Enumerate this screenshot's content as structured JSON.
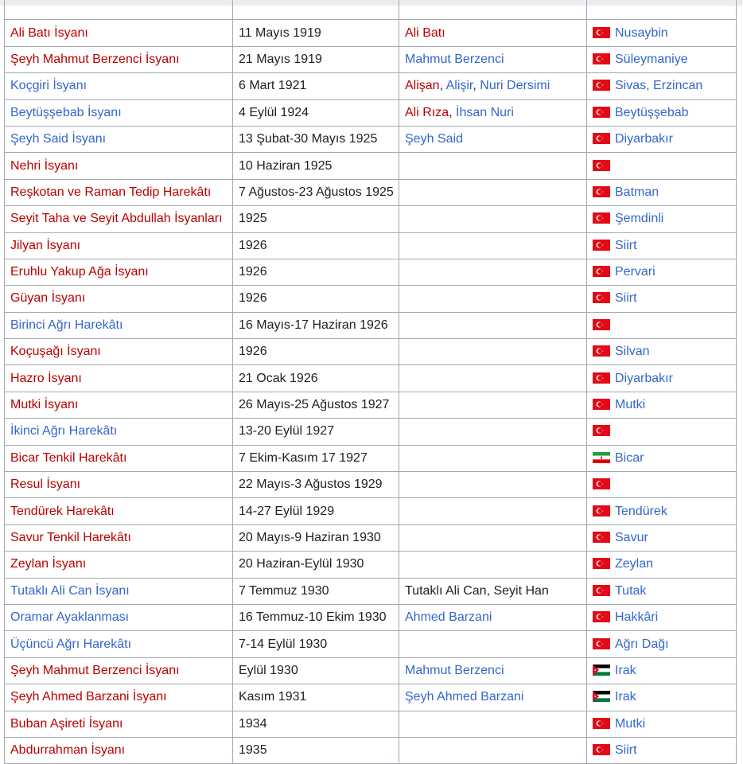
{
  "colors": {
    "link": "#3366cc",
    "redlink": "#ba0000",
    "text": "#202122",
    "border": "#a2a9b1"
  },
  "rows": [
    {
      "name": "",
      "name_style": "blue",
      "date": "",
      "leaders": [],
      "flag": "",
      "place": ""
    },
    {
      "name": "Ali Batı İsyanı",
      "name_style": "red",
      "date": "11 Mayıs 1919",
      "leaders": [
        {
          "text": "Ali Batı",
          "style": "red"
        }
      ],
      "flag": "tr-flag-icon",
      "place": "Nusaybin"
    },
    {
      "name": "Şeyh Mahmut Berzenci İsyanı",
      "name_style": "red",
      "date": "21 Mayıs 1919",
      "leaders": [
        {
          "text": "Mahmut Berzenci",
          "style": "blue"
        }
      ],
      "flag": "tr-flag-icon",
      "place": "Süleymaniye"
    },
    {
      "name": "Koçgiri İsyanı",
      "name_style": "blue",
      "date": "6 Mart 1921",
      "leaders": [
        {
          "text": "Alişan",
          "style": "red"
        },
        {
          "text": ", ",
          "style": "dark"
        },
        {
          "text": "Alişir",
          "style": "blue"
        },
        {
          "text": ", ",
          "style": "dark"
        },
        {
          "text": "Nuri Dersimi",
          "style": "blue"
        }
      ],
      "flag": "tr-flag-icon",
      "place": "Sivas, Erzincan"
    },
    {
      "name": "Beytüşşebab İsyanı",
      "name_style": "blue",
      "date": "4 Eylül 1924",
      "leaders": [
        {
          "text": "Ali Rıza",
          "style": "red"
        },
        {
          "text": ", ",
          "style": "dark"
        },
        {
          "text": "İhsan Nuri",
          "style": "blue"
        }
      ],
      "flag": "tr-flag-icon",
      "place": "Beytüşşebab"
    },
    {
      "name": "Şeyh Said İsyanı",
      "name_style": "blue",
      "date": "13 Şubat-30 Mayıs 1925",
      "leaders": [
        {
          "text": "Şeyh Said",
          "style": "blue"
        }
      ],
      "flag": "tr-flag-icon",
      "place": "Diyarbakır"
    },
    {
      "name": "Nehri İsyanı",
      "name_style": "red",
      "date": "10 Haziran 1925",
      "leaders": [],
      "flag": "tr-flag-icon",
      "place": ""
    },
    {
      "name": "Reşkotan ve Raman Tedip Harekâtı",
      "name_style": "red",
      "date": "7 Ağustos-23 Ağustos 1925",
      "leaders": [],
      "flag": "tr-flag-icon",
      "place": "Batman"
    },
    {
      "name": "Seyit Taha ve Seyit Abdullah İsyanları",
      "name_style": "red",
      "date": "1925",
      "leaders": [],
      "flag": "tr-flag-icon",
      "place": "Şemdinli"
    },
    {
      "name": "Jilyan İsyanı",
      "name_style": "red",
      "date": "1926",
      "leaders": [],
      "flag": "tr-flag-icon",
      "place": "Siirt"
    },
    {
      "name": "Eruhlu Yakup Ağa İsyanı",
      "name_style": "red",
      "date": "1926",
      "leaders": [],
      "flag": "tr-flag-icon",
      "place": "Pervari"
    },
    {
      "name": "Güyan İsyanı",
      "name_style": "red",
      "date": "1926",
      "leaders": [],
      "flag": "tr-flag-icon",
      "place": "Siirt"
    },
    {
      "name": "Birinci Ağrı Harekâtı",
      "name_style": "blue",
      "date": "16 Mayıs-17 Haziran 1926",
      "leaders": [],
      "flag": "tr-flag-icon",
      "place": ""
    },
    {
      "name": "Koçuşağı İsyanı",
      "name_style": "red",
      "date": "1926",
      "leaders": [],
      "flag": "tr-flag-icon",
      "place": "Silvan"
    },
    {
      "name": "Hazro İsyanı",
      "name_style": "red",
      "date": "21 Ocak 1926",
      "leaders": [],
      "flag": "tr-flag-icon",
      "place": "Diyarbakır"
    },
    {
      "name": "Mutki İsyanı",
      "name_style": "red",
      "date": "26 Mayıs-25 Ağustos 1927",
      "leaders": [],
      "flag": "tr-flag-icon",
      "place": "Mutki"
    },
    {
      "name": "İkinci Ağrı Harekâtı",
      "name_style": "blue",
      "date": "13-20 Eylül 1927",
      "leaders": [],
      "flag": "tr-flag-icon",
      "place": ""
    },
    {
      "name": "Bicar Tenkil Harekâtı",
      "name_style": "red",
      "date": "7 Ekim-Kasım 17 1927",
      "leaders": [],
      "flag": "iran-flag-icon",
      "place": "Bicar"
    },
    {
      "name": "Resul İsyanı",
      "name_style": "red",
      "date": "22 Mayıs-3 Ağustos 1929",
      "leaders": [],
      "flag": "tr-flag-icon",
      "place": ""
    },
    {
      "name": "Tendürek Harekâtı",
      "name_style": "red",
      "date": "14-27 Eylül 1929",
      "leaders": [],
      "flag": "tr-flag-icon",
      "place": "Tendürek"
    },
    {
      "name": "Savur Tenkil Harekâtı",
      "name_style": "red",
      "date": "20 Mayıs-9 Haziran 1930",
      "leaders": [],
      "flag": "tr-flag-icon",
      "place": "Savur"
    },
    {
      "name": "Zeylan İsyanı",
      "name_style": "red",
      "date": "20 Haziran-Eylül 1930",
      "leaders": [],
      "flag": "tr-flag-icon",
      "place": "Zeylan"
    },
    {
      "name": "Tutaklı Ali Can İsyanı",
      "name_style": "blue",
      "date": "7 Temmuz 1930",
      "leaders": [
        {
          "text": "Tutaklı Ali Can, Seyit Han",
          "style": "dark"
        }
      ],
      "flag": "tr-flag-icon",
      "place": "Tutak"
    },
    {
      "name": "Oramar Ayaklanması",
      "name_style": "blue",
      "date": "16 Temmuz-10 Ekim 1930",
      "leaders": [
        {
          "text": "Ahmed Barzani",
          "style": "blue"
        }
      ],
      "flag": "tr-flag-icon",
      "place": "Hakkâri"
    },
    {
      "name": "Üçüncü Ağrı Harekâtı",
      "name_style": "blue",
      "date": "7-14 Eylül 1930",
      "leaders": [],
      "flag": "tr-flag-icon",
      "place": "Ağrı Dağı"
    },
    {
      "name": "Şeyh Mahmut Berzenci İsyanı",
      "name_style": "red",
      "date": "Eylül 1930",
      "leaders": [
        {
          "text": "Mahmut Berzenci",
          "style": "blue"
        }
      ],
      "flag": "iraq-flag-icon",
      "place": "Irak"
    },
    {
      "name": "Şeyh Ahmed Barzani İsyanı",
      "name_style": "red",
      "date": "Kasım 1931",
      "leaders": [
        {
          "text": "Şeyh Ahmed Barzani",
          "style": "blue"
        }
      ],
      "flag": "iraq-flag-icon",
      "place": "Irak"
    },
    {
      "name": "Buban Aşireti İsyanı",
      "name_style": "red",
      "date": "1934",
      "leaders": [],
      "flag": "tr-flag-icon",
      "place": "Mutki"
    },
    {
      "name": "Abdurrahman İsyanı",
      "name_style": "red",
      "date": "1935",
      "leaders": [],
      "flag": "tr-flag-icon",
      "place": "Siirt"
    }
  ]
}
